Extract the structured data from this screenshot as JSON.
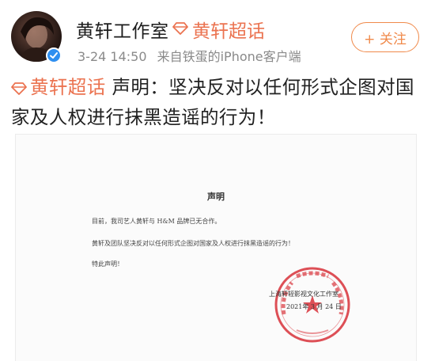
{
  "post": {
    "author": "黄轩工作室",
    "topic_label": "黄轩超话",
    "timestamp": "3-24 14:50",
    "source": "来自铁蛋的iPhone客户端",
    "follow_label": "+ 关注",
    "text_topic": "黄轩超话",
    "text_body": " 声明：坚决反对以任何形式企图对国家及人权进行抹黑造谣的行为！"
  },
  "document": {
    "title": "声明",
    "paragraphs": [
      "目前，我司艺人黄轩与 H&M 品牌已无合作。",
      "黄轩及团队坚决反对以任何形式企图对国家及人权进行抹黑造谣的行为！",
      "特此声明！"
    ],
    "signature": "上海轩轾影视文化工作室",
    "date": "2021年 3 月 24 日"
  },
  "colors": {
    "accent": "#eb7350",
    "follow": "#f08a4b",
    "verified": "#2e8ff0",
    "seal": "#d8323a"
  }
}
